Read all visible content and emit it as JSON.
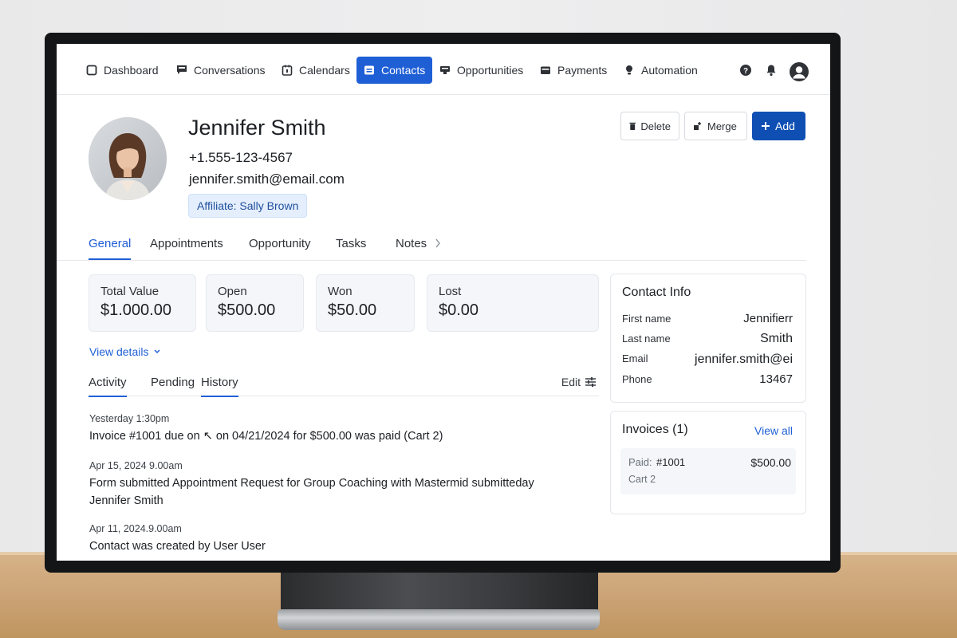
{
  "colors": {
    "accent": "#1f5fd6",
    "primary_button": "#0f4fb4",
    "affiliate_bg": "#e4eefc",
    "card_bg": "#f4f6f9"
  },
  "nav": {
    "items": [
      {
        "label": "Dashboard",
        "icon": "dashboard-icon",
        "active": false
      },
      {
        "label": "Conversations",
        "icon": "chat-icon",
        "active": false
      },
      {
        "label": "Calendars",
        "icon": "calendar-icon",
        "active": false
      },
      {
        "label": "Contacts",
        "icon": "contacts-icon",
        "active": true
      },
      {
        "label": "Opportunities",
        "icon": "opportunities-icon",
        "active": false
      },
      {
        "label": "Payments",
        "icon": "wallet-icon",
        "active": false
      },
      {
        "label": "Automation",
        "icon": "automation-icon",
        "active": false
      }
    ],
    "right_icons": [
      "help-icon",
      "bell-icon",
      "user-avatar-icon"
    ]
  },
  "contact": {
    "name": "Jennifer Smith",
    "phone": "+1.555-123-4567",
    "email": "jennifer.smith@email.com",
    "affiliate": "Affiliate: Sally Brown"
  },
  "actions": {
    "delete": "Delete",
    "merge": "Merge",
    "add": "Add"
  },
  "tabs": [
    {
      "label": "General",
      "active": true
    },
    {
      "label": "Appointments",
      "active": false
    },
    {
      "label": "Opportunity",
      "active": false
    },
    {
      "label": "Tasks",
      "active": false
    },
    {
      "label": "Notes",
      "active": false
    }
  ],
  "stats": [
    {
      "label": "Total Value",
      "value": "$1.000.00"
    },
    {
      "label": "Open",
      "value": "$500.00"
    },
    {
      "label": "Won",
      "value": "$50.00"
    },
    {
      "label": "Lost",
      "value": "$0.00"
    }
  ],
  "view_details": "View details",
  "subtabs": [
    {
      "label": "Activity",
      "active": true
    },
    {
      "label": "Pending",
      "active": false
    },
    {
      "label": "History",
      "active": true
    }
  ],
  "edit_label": "Edit",
  "activity": [
    {
      "time": "Yesterday 1:30pm",
      "text": "Invoice #1001 due on ↖ on 04/21/2024 for $500.00 was paid (Cart 2)"
    },
    {
      "time": "Apr 15, 2024 9.00am",
      "text": "Form submitted  Appointment Request for Group Coaching with Mastermid submitteday Jennifer Smith"
    },
    {
      "time": "Apr 11, 2024.9.00am",
      "text": "Contact was created by User User"
    }
  ],
  "contact_info": {
    "title": "Contact Info",
    "rows": [
      {
        "label": "First name",
        "value": "Jennifierr"
      },
      {
        "label": "Last name",
        "value": "Smith"
      },
      {
        "label": "Email",
        "value": "jennifer.smith@ei"
      },
      {
        "label": "Phone",
        "value": "13467"
      }
    ]
  },
  "invoices": {
    "title": "Invoices (1)",
    "view_all": "View all",
    "item": {
      "status": "Paid:",
      "number": "#1001",
      "amount": "$500.00",
      "cart": "Cart 2"
    }
  }
}
